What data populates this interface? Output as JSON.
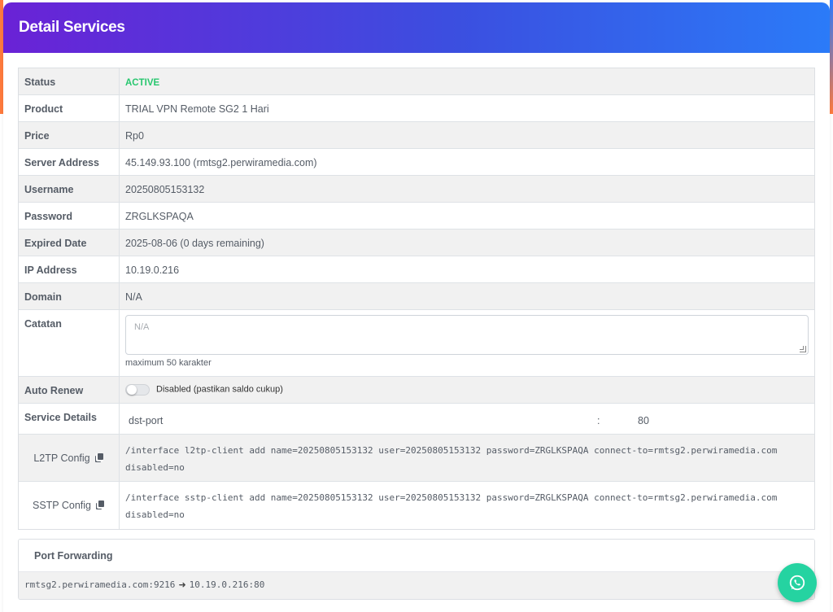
{
  "header": {
    "title": "Detail Services"
  },
  "details": {
    "status_label": "Status",
    "status_value": "ACTIVE",
    "product_label": "Product",
    "product_value": "TRIAL VPN Remote SG2 1 Hari",
    "price_label": "Price",
    "price_value": "Rp0",
    "server_label": "Server Address",
    "server_value": "45.149.93.100 (rmtsg2.perwiramedia.com)",
    "username_label": "Username",
    "username_value": "20250805153132",
    "password_label": "Password",
    "password_value": "ZRGLKSPAQA",
    "expired_label": "Expired Date",
    "expired_value": "2025-08-06 (0 days remaining)",
    "ip_label": "IP Address",
    "ip_value": "10.19.0.216",
    "domain_label": "Domain",
    "domain_value": "N/A",
    "catatan_label": "Catatan",
    "catatan_placeholder": "N/A",
    "catatan_hint": "maximum 50 karakter",
    "autorenew_label": "Auto Renew",
    "autorenew_text": "Disabled (pastikan saldo cukup)",
    "autorenew_enabled": false,
    "service_details_label": "Service Details",
    "service_details_key": "dst-port",
    "service_details_sep": ":",
    "service_details_value": "80"
  },
  "configs": {
    "l2tp_label": "L2TP Config",
    "l2tp_line1": "/interface l2tp-client add name=20250805153132 user=20250805153132 password=ZRGLKSPAQA connect-to=rmtsg2.perwiramedia.com",
    "l2tp_line2": "disabled=no",
    "sstp_label": "SSTP Config",
    "sstp_line1": "/interface sstp-client add name=20250805153132 user=20250805153132 password=ZRGLKSPAQA connect-to=rmtsg2.perwiramedia.com",
    "sstp_line2": "disabled=no"
  },
  "port_forwarding": {
    "title": "Port Forwarding",
    "source": "rmtsg2.perwiramedia.com:9216",
    "target": "10.19.0.216:80"
  },
  "colors": {
    "header_gradient_start": "#6a22d6",
    "header_gradient_end": "#2b7bf8",
    "status_active": "#28c76f",
    "whatsapp": "#25d3a1"
  },
  "icons": {
    "copy": "copy-icon",
    "arrow": "arrow-right-icon",
    "whatsapp": "whatsapp-icon"
  }
}
